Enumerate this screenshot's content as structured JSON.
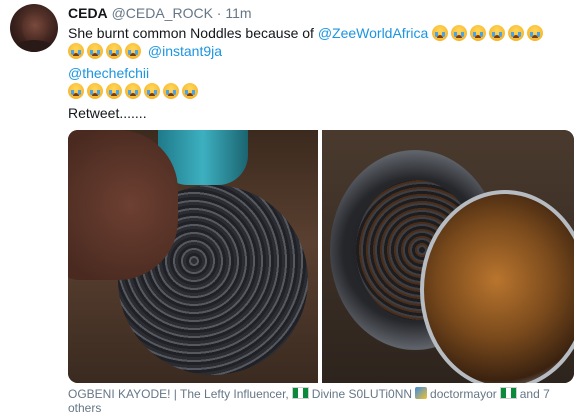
{
  "tweet": {
    "display_name": "CEDA",
    "handle": "@CEDA_ROCK",
    "separator": "·",
    "time": "11m",
    "text_prefix": "She burnt common Noddles because of",
    "mention_1": "@ZeeWorldAfrica",
    "mention_2": "@instant9ja",
    "mention_3": "@thechefchii",
    "retweet_text": "Retweet.......",
    "emoji": "crying-face-emoji",
    "emoji_row1_count": 6,
    "emoji_row2_count": 4,
    "emoji_row4_count": 7
  },
  "media": {
    "left_photo": "burnt-noodles-in-hand-photo",
    "right_photo": "burnt-noodles-in-pot-photo"
  },
  "liked_by": {
    "user_1": "OGBENI KAYODE! | The Lefty Influencer,",
    "user_2": "Divine S0LUTi0NN",
    "user_3": "doctormayor",
    "suffix": "and 7",
    "suffix_2": "others"
  },
  "colors": {
    "link": "#1b95e0",
    "muted": "#657786",
    "text": "#14171a"
  }
}
